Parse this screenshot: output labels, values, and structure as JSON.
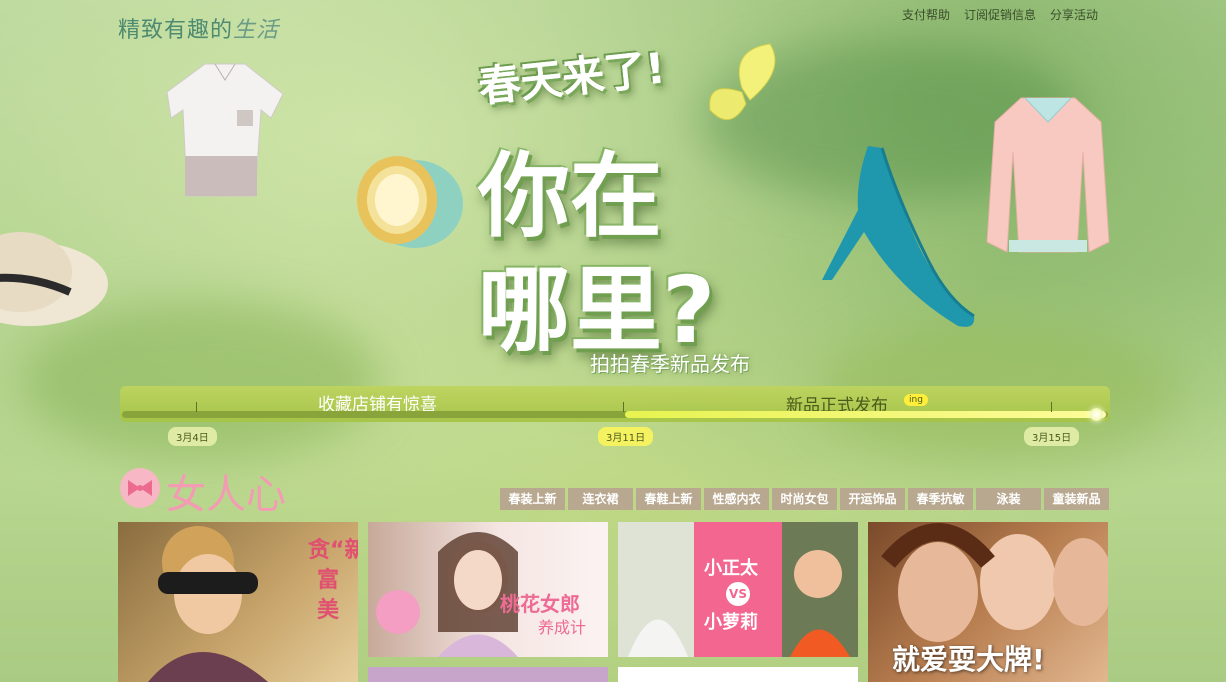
{
  "header": {
    "logo_text": "精致有趣的",
    "logo_accent": "生活",
    "links": [
      "支付帮助",
      "订阅促销信息",
      "分享活动"
    ]
  },
  "banner": {
    "line1": "春天来了!",
    "line2": "你在",
    "line3": "哪里?",
    "subtitle": "拍拍春季新品发布"
  },
  "timeline": {
    "label_left": "收藏店铺有惊喜",
    "label_right": "新品正式发布",
    "badge": "ing",
    "dates": [
      "3月4日",
      "3月11日",
      "3月15日"
    ],
    "progress_fraction": 1.0
  },
  "section": {
    "title": "女人心",
    "tabs": [
      "春装上新",
      "连衣裙",
      "春鞋上新",
      "性感内衣",
      "时尚女包",
      "开运饰品",
      "春季抗敏",
      "泳装",
      "童装新品"
    ]
  },
  "cards": {
    "card1_text": "贪“新”白富美",
    "card2_title": "桃花女郎",
    "card2_sub": "养成计",
    "card3_top": "小正太",
    "card3_vs": "VS",
    "card3_bottom": "小萝莉",
    "card4_text": "就爱耍大牌!"
  },
  "colors": {
    "accent_pink": "#f49bb4",
    "tab_bg": "#b9a890",
    "timeline_green": "#a6c446",
    "highlight_yellow": "#f5f262"
  },
  "icons": [
    "bow-icon",
    "butterfly-icon",
    "hat-icon",
    "shirt-icon",
    "jar-icon",
    "shoe-icon",
    "blouse-icon"
  ]
}
